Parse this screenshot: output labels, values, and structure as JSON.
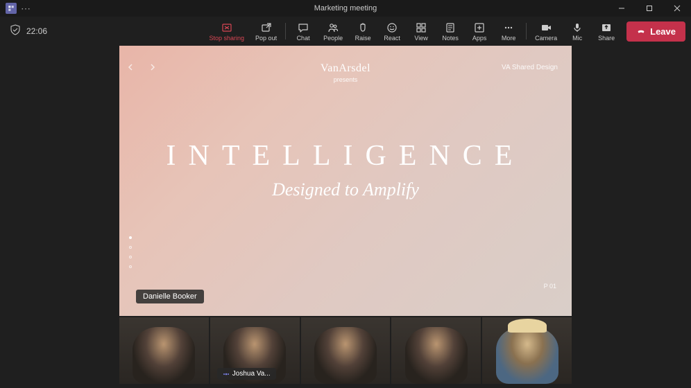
{
  "titlebar": {
    "meeting_title": "Marketing meeting"
  },
  "topbar": {
    "timer": "22:06",
    "buttons": {
      "stop_sharing": "Stop sharing",
      "pop_out": "Pop out",
      "chat": "Chat",
      "people": "People",
      "raise": "Raise",
      "react": "React",
      "view": "View",
      "notes": "Notes",
      "apps": "Apps",
      "more": "More",
      "camera": "Camera",
      "mic": "Mic",
      "share": "Share",
      "leave": "Leave"
    }
  },
  "slide": {
    "brand_name": "VanArsdel",
    "brand_sub": "presents",
    "tag": "VA Shared Design",
    "headline": "INTELLIGENCE",
    "subhead": "Designed to Amplify",
    "page_num": "P 01",
    "presenter": "Danielle Booker"
  },
  "participants": [
    {
      "name": ""
    },
    {
      "name": "Joshua Va..."
    },
    {
      "name": ""
    },
    {
      "name": ""
    },
    {
      "name": ""
    }
  ]
}
